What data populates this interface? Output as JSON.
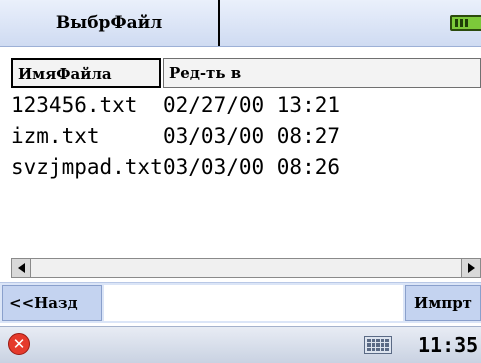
{
  "window": {
    "title": "ВыбрФайл"
  },
  "table": {
    "headers": [
      "ИмяФайла",
      "Ред-ть в"
    ],
    "rows": [
      {
        "name": "123456.txt",
        "modified": "02/27/00 13:21"
      },
      {
        "name": "izm.txt",
        "modified": "03/03/00 08:27"
      },
      {
        "name": "svzjmpad.txt",
        "modified": "03/03/00 08:26"
      }
    ]
  },
  "buttons": {
    "back": "<<Назд",
    "import": "Импрт"
  },
  "taskbar": {
    "time": "11:35",
    "icons": [
      "close-circle-icon",
      "keyboard-icon",
      "battery-icon"
    ]
  },
  "colors": {
    "accent": "#c4d3f0",
    "battery": "#7cc93a",
    "close": "#e53a2c"
  }
}
